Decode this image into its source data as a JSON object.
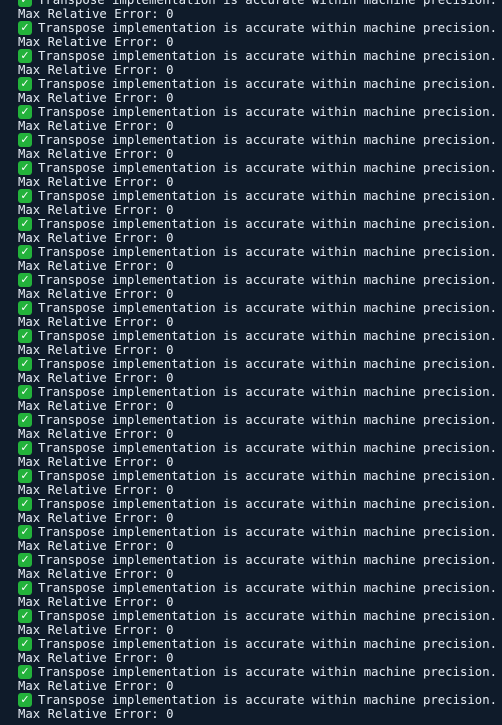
{
  "terminal": {
    "check_glyph": "✓",
    "success_text": "Transpose implementation is accurate within machine precision.",
    "error_label": "Max Relative Error: 0",
    "entries": [
      {
        "success": "Transpose implementation is accurate within machine precision.",
        "error": "Max Relative Error: 0"
      },
      {
        "success": "Transpose implementation is accurate within machine precision.",
        "error": "Max Relative Error: 0"
      },
      {
        "success": "Transpose implementation is accurate within machine precision.",
        "error": "Max Relative Error: 0"
      },
      {
        "success": "Transpose implementation is accurate within machine precision.",
        "error": "Max Relative Error: 0"
      },
      {
        "success": "Transpose implementation is accurate within machine precision.",
        "error": "Max Relative Error: 0"
      },
      {
        "success": "Transpose implementation is accurate within machine precision.",
        "error": "Max Relative Error: 0"
      },
      {
        "success": "Transpose implementation is accurate within machine precision.",
        "error": "Max Relative Error: 0"
      },
      {
        "success": "Transpose implementation is accurate within machine precision.",
        "error": "Max Relative Error: 0"
      },
      {
        "success": "Transpose implementation is accurate within machine precision.",
        "error": "Max Relative Error: 0"
      },
      {
        "success": "Transpose implementation is accurate within machine precision.",
        "error": "Max Relative Error: 0"
      },
      {
        "success": "Transpose implementation is accurate within machine precision.",
        "error": "Max Relative Error: 0"
      },
      {
        "success": "Transpose implementation is accurate within machine precision.",
        "error": "Max Relative Error: 0"
      },
      {
        "success": "Transpose implementation is accurate within machine precision.",
        "error": "Max Relative Error: 0"
      },
      {
        "success": "Transpose implementation is accurate within machine precision.",
        "error": "Max Relative Error: 0"
      },
      {
        "success": "Transpose implementation is accurate within machine precision.",
        "error": "Max Relative Error: 0"
      },
      {
        "success": "Transpose implementation is accurate within machine precision.",
        "error": "Max Relative Error: 0"
      },
      {
        "success": "Transpose implementation is accurate within machine precision.",
        "error": "Max Relative Error: 0"
      },
      {
        "success": "Transpose implementation is accurate within machine precision.",
        "error": "Max Relative Error: 0"
      },
      {
        "success": "Transpose implementation is accurate within machine precision.",
        "error": "Max Relative Error: 0"
      },
      {
        "success": "Transpose implementation is accurate within machine precision.",
        "error": "Max Relative Error: 0"
      },
      {
        "success": "Transpose implementation is accurate within machine precision.",
        "error": "Max Relative Error: 0"
      },
      {
        "success": "Transpose implementation is accurate within machine precision.",
        "error": "Max Relative Error: 0"
      },
      {
        "success": "Transpose implementation is accurate within machine precision.",
        "error": "Max Relative Error: 0"
      },
      {
        "success": "Transpose implementation is accurate within machine precision.",
        "error": "Max Relative Error: 0"
      },
      {
        "success": "Transpose implementation is accurate within machine precision.",
        "error": "Max Relative Error: 0"
      },
      {
        "success": "Transpose implementation is accurate within machine precision.",
        "error": "Max Relative Error: 0"
      }
    ]
  },
  "colors": {
    "background": "#0f1b2a",
    "text": "#e6edf5",
    "check_badge": "#23b23b"
  },
  "icons": {
    "check": "white-heavy-check-mark-icon"
  }
}
